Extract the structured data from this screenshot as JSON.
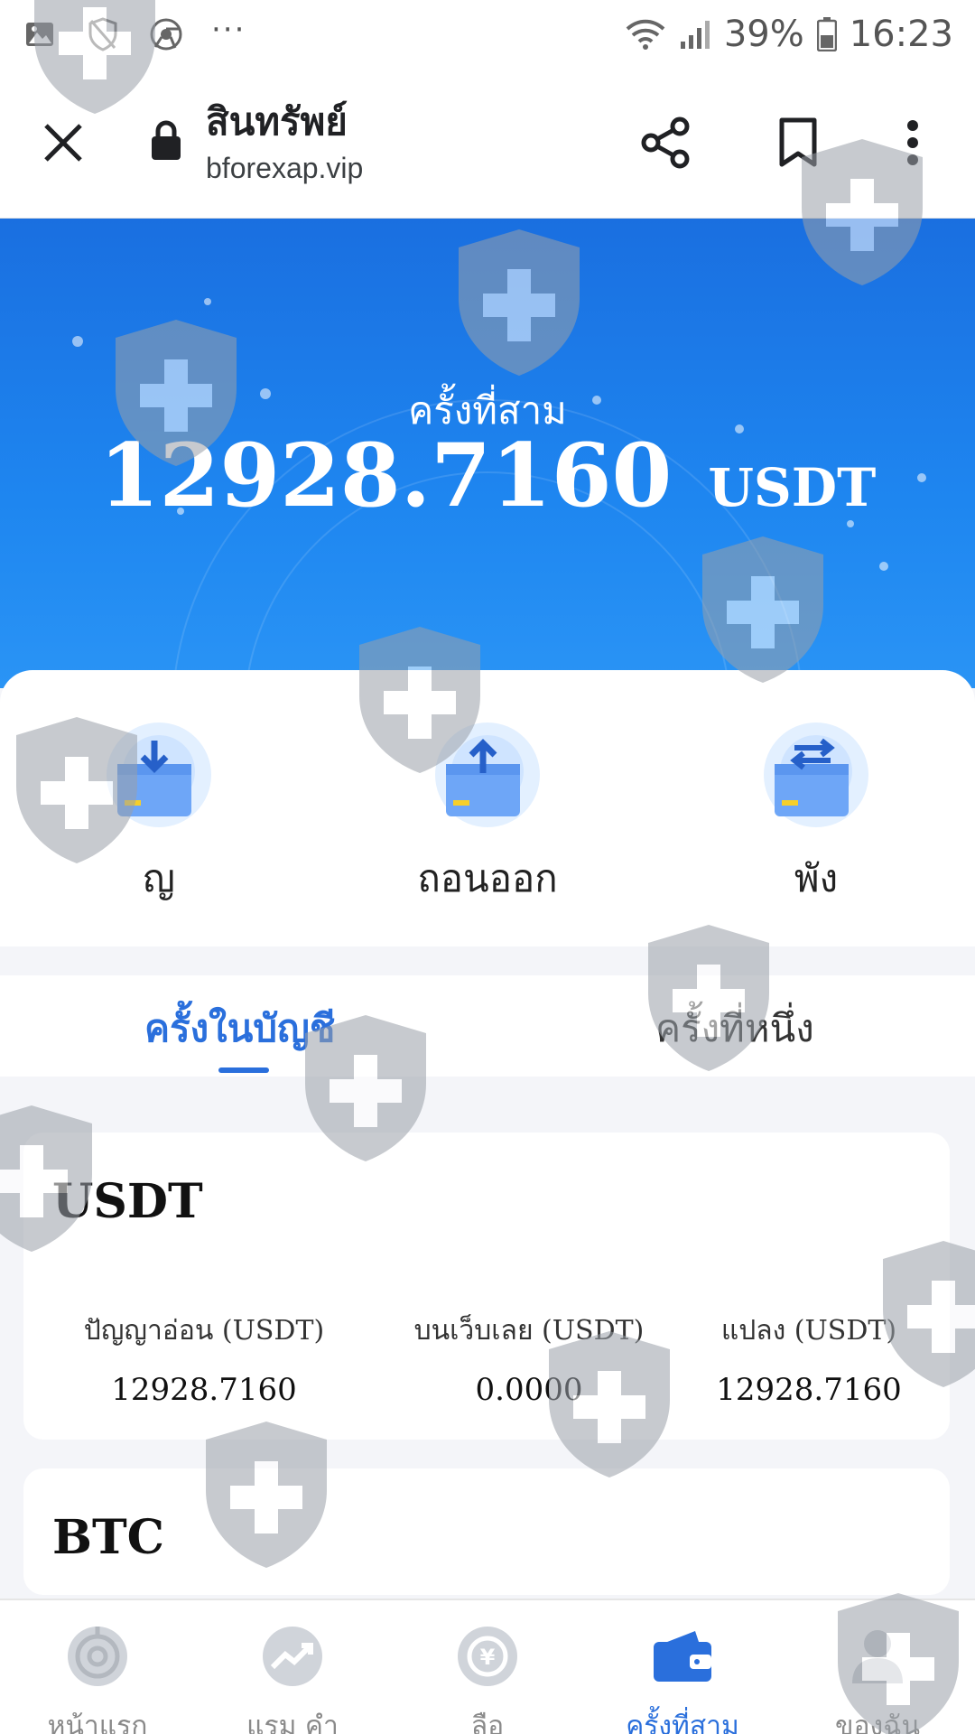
{
  "status_bar": {
    "battery_percent": "39%",
    "time": "16:23",
    "more_dots": "···"
  },
  "browser": {
    "title": "สินทรัพย์",
    "url": "bforexap.vip"
  },
  "asset_header": {
    "label": "ครั้งที่สาม",
    "amount": "12928.7160",
    "unit": "USDT"
  },
  "actions": {
    "deposit_label": "ญ",
    "withdraw_label": "ถอนออก",
    "transfer_label": "พัง"
  },
  "tabs": {
    "account_label": "ครั้งในบัญชี",
    "other_label": "ครั้งที่หนึ่ง"
  },
  "currencies": [
    {
      "name": "USDT",
      "stats": [
        {
          "label": "ปัญญาอ่อน (USDT)",
          "value": "12928.7160"
        },
        {
          "label": "บนเว็บเลย (USDT)",
          "value": "0.0000"
        },
        {
          "label": "แปลง (USDT)",
          "value": "12928.7160"
        }
      ]
    },
    {
      "name": "BTC"
    }
  ],
  "bottom_nav": [
    {
      "label": "หน้าแรก",
      "icon": "home-target-icon",
      "active": false
    },
    {
      "label": "แรม คำ",
      "icon": "trend-chart-icon",
      "active": false
    },
    {
      "label": "ลือ",
      "icon": "currency-exchange-icon",
      "active": false
    },
    {
      "label": "ครั้งที่สาม",
      "icon": "wallet-icon",
      "active": true
    },
    {
      "label": "ของฉัน",
      "icon": "user-icon",
      "active": false
    }
  ],
  "colors": {
    "accent": "#2a6fdc",
    "header_blue": "#1e86f0",
    "inactive_nav": "#8a8a8a"
  }
}
